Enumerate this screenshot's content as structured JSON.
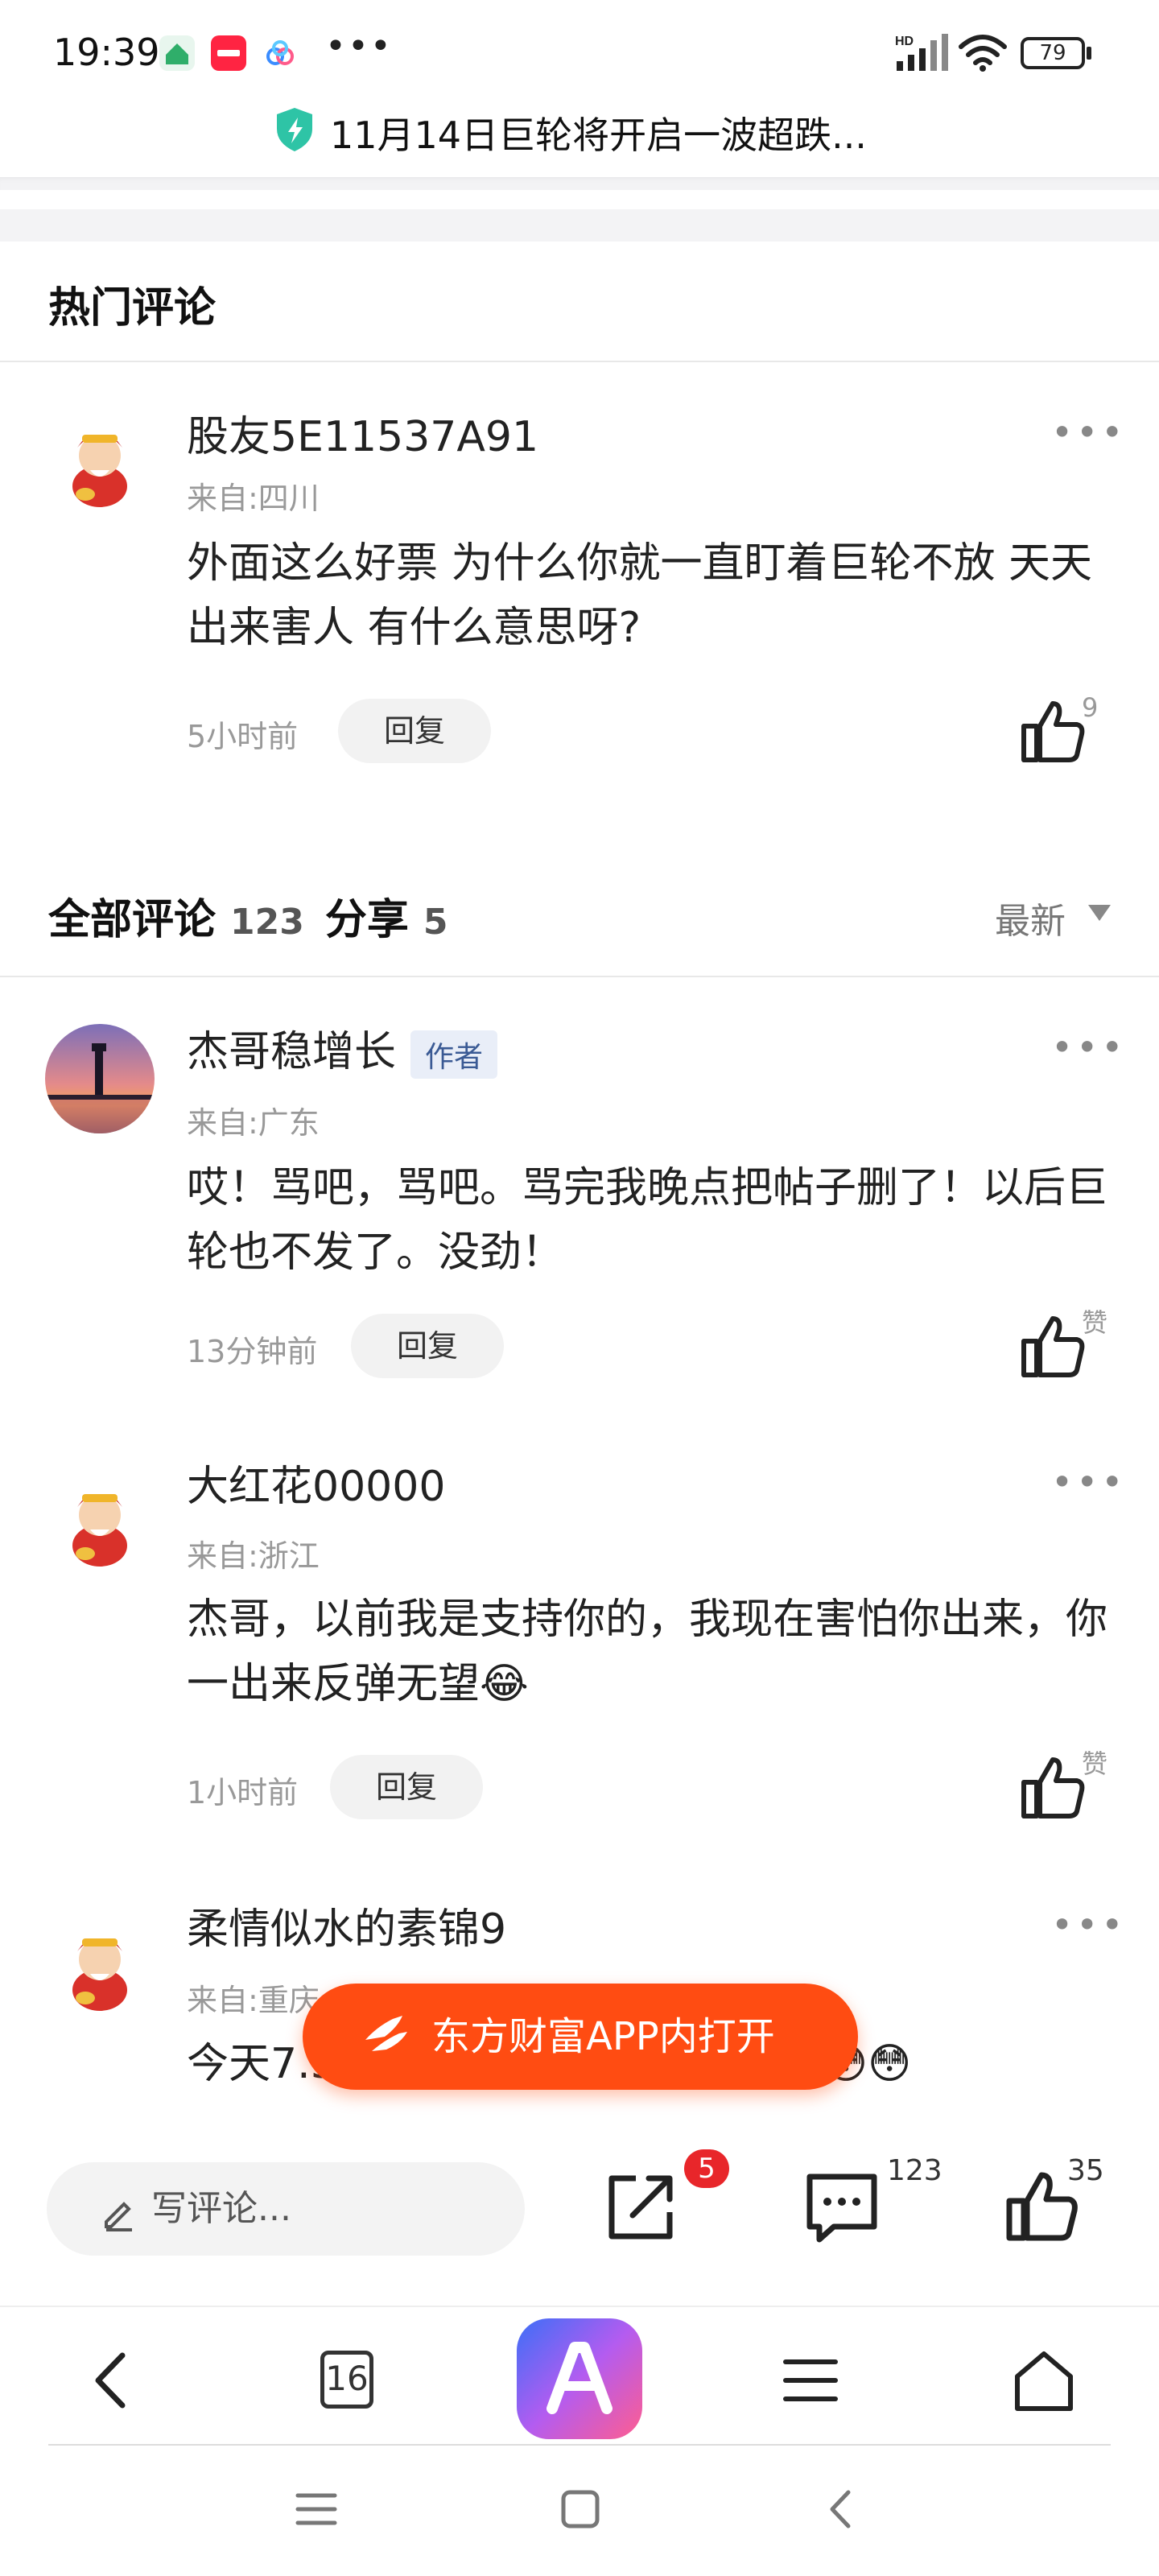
{
  "status_bar": {
    "time": "19:39",
    "network_label": "HD",
    "battery": "79"
  },
  "url_bar": {
    "title": "11月14日巨轮将开启一波超跌..."
  },
  "hot_comments": {
    "title": "热门评论",
    "items": [
      {
        "username": "股友5E11537A91",
        "location": "来自:四川",
        "content": "外面这么好票 为什么你就一直盯着巨轮不放 天天出来害人 有什么意思呀?",
        "time": "5小时前",
        "reply": "回复",
        "likes": "9"
      }
    ]
  },
  "all_comments": {
    "title": "全部评论",
    "count": "123",
    "share_label": "分享",
    "share_count": "5",
    "sort_label": "最新",
    "items": [
      {
        "username": "杰哥稳增长",
        "badge": "作者",
        "location": "来自:广东",
        "content": "哎！骂吧，骂吧。骂完我晚点把帖子删了！以后巨轮也不发了。没劲！",
        "time": "13分钟前",
        "reply": "回复",
        "likes": "赞"
      },
      {
        "username": "大红花00000",
        "location": "来自:浙江",
        "content": "杰哥，以前我是支持你的，我现在害怕你出来，你一出来反弹无望😂",
        "time": "1小时前",
        "reply": "回复",
        "likes": "赞"
      },
      {
        "username": "柔情似水的素锦9",
        "location": "来自:重庆",
        "content": "今天7.50进的，生死一搏跑到拌不😳😳"
      }
    ]
  },
  "open_app_button": "东方财富APP内打开",
  "action_bar": {
    "write_placeholder": "写评论...",
    "share_badge": "5",
    "comment_count": "123",
    "like_count": "35"
  },
  "browser_nav": {
    "tabs_count": "16"
  },
  "colors": {
    "accent": "#ff4c12",
    "badge_red": "#e8262a",
    "author_badge_bg": "#e9eef8",
    "author_badge_text": "#3a5a94"
  }
}
